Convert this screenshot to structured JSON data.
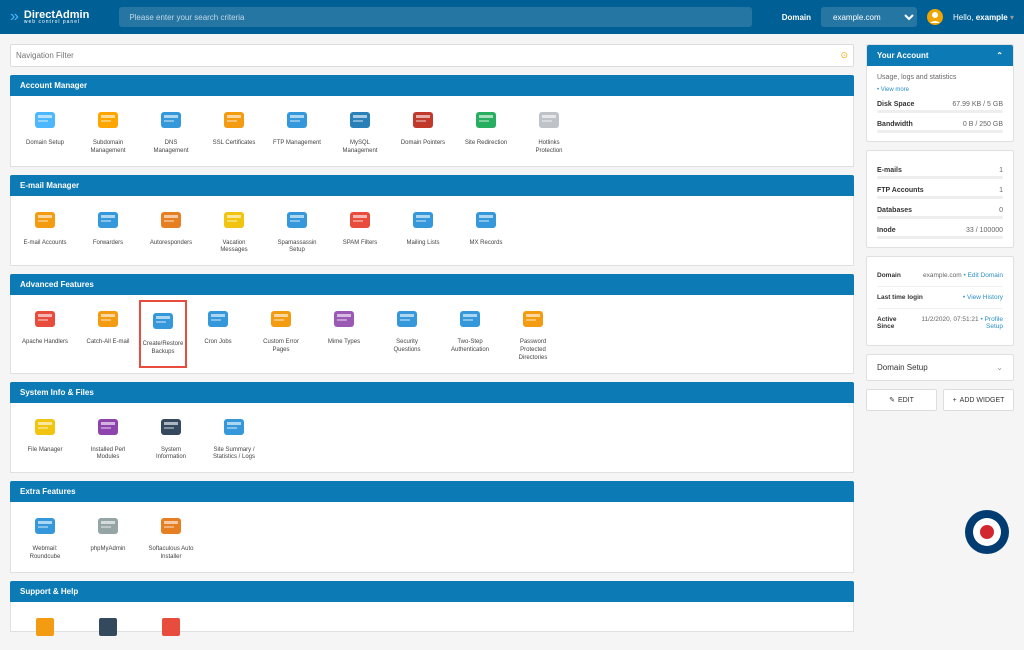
{
  "header": {
    "logo_title": "DirectAdmin",
    "logo_subtitle": "web control panel",
    "search_placeholder": "Please enter your search criteria",
    "domain_label": "Domain",
    "domain_value": "example.com",
    "hello_prefix": "Hello, ",
    "hello_user": "example"
  },
  "nav_filter_placeholder": "Navigation Filter",
  "sections": {
    "account_manager": {
      "title": "Account Manager",
      "items": [
        "Domain Setup",
        "Subdomain Management",
        "DNS Management",
        "SSL Certificates",
        "FTP Management",
        "MySQL Management",
        "Domain Pointers",
        "Site Redirection",
        "Hotlinks Protection"
      ]
    },
    "email_manager": {
      "title": "E-mail Manager",
      "items": [
        "E-mail Accounts",
        "Forwarders",
        "Autoresponders",
        "Vacation Messages",
        "Spamassassin Setup",
        "SPAM Filters",
        "Mailing Lists",
        "MX Records"
      ]
    },
    "advanced": {
      "title": "Advanced Features",
      "items": [
        "Apache Handlers",
        "Catch-All E-mail",
        "Create/Restore Backups",
        "Cron Jobs",
        "Custom Error Pages",
        "Mime Types",
        "Security Questions",
        "Two-Step Authentication",
        "Password Protected Directories"
      ]
    },
    "system_info": {
      "title": "System Info & Files",
      "items": [
        "File Manager",
        "Installed Perl Modules",
        "System Information",
        "Site Summary / Statistics / Logs"
      ]
    },
    "extra": {
      "title": "Extra Features",
      "items": [
        "Webmail: Roundcube",
        "phpMyAdmin",
        "Softaculous Auto Installer"
      ]
    },
    "support": {
      "title": "Support & Help"
    }
  },
  "account_widget": {
    "title": "Your Account",
    "subtitle": "Usage, logs and statistics",
    "view_more": "• View more",
    "disk_space_label": "Disk Space",
    "disk_space_value": "67.99 KB / 5 GB",
    "bandwidth_label": "Bandwidth",
    "bandwidth_value": "0 B / 250 GB",
    "emails_label": "E-mails",
    "emails_value": "1",
    "ftp_label": "FTP Accounts",
    "ftp_value": "1",
    "db_label": "Databases",
    "db_value": "0",
    "inode_label": "Inode",
    "inode_value": "33 / 100000",
    "domain_label": "Domain",
    "domain_value": "example.com",
    "edit_domain": "• Edit Domain",
    "last_login_label": "Last time login",
    "last_login_link": "• View History",
    "active_since_label": "Active Since",
    "active_since_value": "11/2/2020, 07:51:21",
    "profile_setup": "• Profile Setup"
  },
  "domain_setup_label": "Domain Setup",
  "edit_button": "EDIT",
  "add_widget_button": "ADD WIDGET",
  "icons": {
    "account": [
      "#4db8ff",
      "#ffa500",
      "#3498db",
      "#f39c12",
      "#3498db",
      "#2980b9",
      "#c0392b",
      "#27ae60",
      "#bdc3c7"
    ],
    "email": [
      "#f39c12",
      "#3498db",
      "#e67e22",
      "#f1c40f",
      "#3498db",
      "#e74c3c",
      "#3498db",
      "#3498db"
    ],
    "advanced": [
      "#e74c3c",
      "#f39c12",
      "#3498db",
      "#3498db",
      "#f39c12",
      "#9b59b6",
      "#3498db",
      "#3498db",
      "#f39c12"
    ],
    "system": [
      "#f1c40f",
      "#8e44ad",
      "#34495e",
      "#3498db"
    ],
    "extra": [
      "#3498db",
      "#95a5a6",
      "#e67e22"
    ]
  }
}
